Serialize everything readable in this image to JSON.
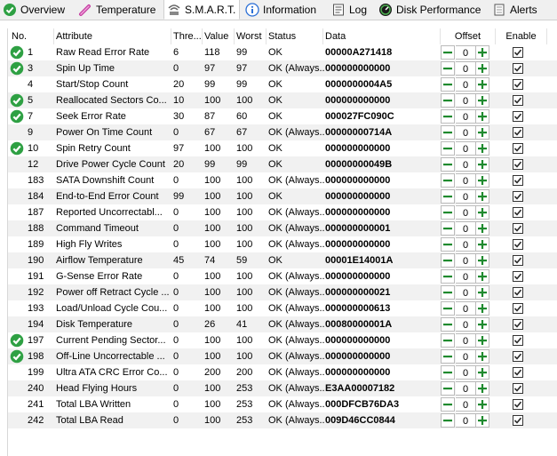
{
  "tabs": [
    {
      "label": "Overview",
      "icon": "check-circle-icon",
      "active": false
    },
    {
      "label": "Temperature",
      "icon": "thermometer-icon",
      "active": false
    },
    {
      "label": "S.M.A.R.T.",
      "icon": "smart-icon",
      "active": true
    },
    {
      "label": "Information",
      "icon": "info-icon",
      "active": false
    },
    {
      "label": "Log",
      "icon": "log-icon",
      "active": false
    },
    {
      "label": "Disk Performance",
      "icon": "disk-performance-icon",
      "active": false
    },
    {
      "label": "Alerts",
      "icon": "alerts-icon",
      "active": false
    }
  ],
  "columns": {
    "no": "No.",
    "attribute": "Attribute",
    "threshold": "Thre...",
    "value": "Value",
    "worst": "Worst",
    "status": "Status",
    "data": "Data",
    "offset": "Offset",
    "enable": "Enable"
  },
  "colors": {
    "ok_green": "#2ea043",
    "stepper_green": "#1f8a2e",
    "row_alt": "#f1f1f1"
  },
  "rows": [
    {
      "no": "1",
      "attribute": "Raw Read Error Rate",
      "threshold": "6",
      "value": "118",
      "worst": "99",
      "status": "OK",
      "data": "00000A271418",
      "offset": "0",
      "ok_icon": true,
      "enabled": true
    },
    {
      "no": "3",
      "attribute": "Spin Up Time",
      "threshold": "0",
      "value": "97",
      "worst": "97",
      "status": "OK (Always...",
      "data": "000000000000",
      "offset": "0",
      "ok_icon": true,
      "enabled": true
    },
    {
      "no": "4",
      "attribute": "Start/Stop Count",
      "threshold": "20",
      "value": "99",
      "worst": "99",
      "status": "OK",
      "data": "0000000004A5",
      "offset": "0",
      "ok_icon": false,
      "enabled": true
    },
    {
      "no": "5",
      "attribute": "Reallocated Sectors Co...",
      "threshold": "10",
      "value": "100",
      "worst": "100",
      "status": "OK",
      "data": "000000000000",
      "offset": "0",
      "ok_icon": true,
      "enabled": true
    },
    {
      "no": "7",
      "attribute": "Seek Error Rate",
      "threshold": "30",
      "value": "87",
      "worst": "60",
      "status": "OK",
      "data": "000027FC090C",
      "offset": "0",
      "ok_icon": true,
      "enabled": true
    },
    {
      "no": "9",
      "attribute": "Power On Time Count",
      "threshold": "0",
      "value": "67",
      "worst": "67",
      "status": "OK (Always...",
      "data": "00000000714A",
      "offset": "0",
      "ok_icon": false,
      "enabled": true
    },
    {
      "no": "10",
      "attribute": "Spin Retry Count",
      "threshold": "97",
      "value": "100",
      "worst": "100",
      "status": "OK",
      "data": "000000000000",
      "offset": "0",
      "ok_icon": true,
      "enabled": true
    },
    {
      "no": "12",
      "attribute": "Drive Power Cycle Count",
      "threshold": "20",
      "value": "99",
      "worst": "99",
      "status": "OK",
      "data": "00000000049B",
      "offset": "0",
      "ok_icon": false,
      "enabled": true
    },
    {
      "no": "183",
      "attribute": "SATA Downshift Count",
      "threshold": "0",
      "value": "100",
      "worst": "100",
      "status": "OK (Always...",
      "data": "000000000000",
      "offset": "0",
      "ok_icon": false,
      "enabled": true
    },
    {
      "no": "184",
      "attribute": "End-to-End Error Count",
      "threshold": "99",
      "value": "100",
      "worst": "100",
      "status": "OK",
      "data": "000000000000",
      "offset": "0",
      "ok_icon": false,
      "enabled": true
    },
    {
      "no": "187",
      "attribute": "Reported Uncorrectabl...",
      "threshold": "0",
      "value": "100",
      "worst": "100",
      "status": "OK (Always...",
      "data": "000000000000",
      "offset": "0",
      "ok_icon": false,
      "enabled": true
    },
    {
      "no": "188",
      "attribute": "Command Timeout",
      "threshold": "0",
      "value": "100",
      "worst": "100",
      "status": "OK (Always...",
      "data": "000000000001",
      "offset": "0",
      "ok_icon": false,
      "enabled": true
    },
    {
      "no": "189",
      "attribute": "High Fly Writes",
      "threshold": "0",
      "value": "100",
      "worst": "100",
      "status": "OK (Always...",
      "data": "000000000000",
      "offset": "0",
      "ok_icon": false,
      "enabled": true
    },
    {
      "no": "190",
      "attribute": "Airflow Temperature",
      "threshold": "45",
      "value": "74",
      "worst": "59",
      "status": "OK",
      "data": "00001E14001A",
      "offset": "0",
      "ok_icon": false,
      "enabled": true
    },
    {
      "no": "191",
      "attribute": "G-Sense Error Rate",
      "threshold": "0",
      "value": "100",
      "worst": "100",
      "status": "OK (Always...",
      "data": "000000000000",
      "offset": "0",
      "ok_icon": false,
      "enabled": true
    },
    {
      "no": "192",
      "attribute": "Power off Retract Cycle ...",
      "threshold": "0",
      "value": "100",
      "worst": "100",
      "status": "OK (Always...",
      "data": "000000000021",
      "offset": "0",
      "ok_icon": false,
      "enabled": true
    },
    {
      "no": "193",
      "attribute": "Load/Unload Cycle Cou...",
      "threshold": "0",
      "value": "100",
      "worst": "100",
      "status": "OK (Always...",
      "data": "000000000613",
      "offset": "0",
      "ok_icon": false,
      "enabled": true
    },
    {
      "no": "194",
      "attribute": "Disk Temperature",
      "threshold": "0",
      "value": "26",
      "worst": "41",
      "status": "OK (Always...",
      "data": "00080000001A",
      "offset": "0",
      "ok_icon": false,
      "enabled": true
    },
    {
      "no": "197",
      "attribute": "Current Pending Sector...",
      "threshold": "0",
      "value": "100",
      "worst": "100",
      "status": "OK (Always...",
      "data": "000000000000",
      "offset": "0",
      "ok_icon": true,
      "enabled": true
    },
    {
      "no": "198",
      "attribute": "Off-Line Uncorrectable ...",
      "threshold": "0",
      "value": "100",
      "worst": "100",
      "status": "OK (Always...",
      "data": "000000000000",
      "offset": "0",
      "ok_icon": true,
      "enabled": true
    },
    {
      "no": "199",
      "attribute": "Ultra ATA CRC Error Co...",
      "threshold": "0",
      "value": "200",
      "worst": "200",
      "status": "OK (Always...",
      "data": "000000000000",
      "offset": "0",
      "ok_icon": false,
      "enabled": true
    },
    {
      "no": "240",
      "attribute": "Head Flying Hours",
      "threshold": "0",
      "value": "100",
      "worst": "253",
      "status": "OK (Always...",
      "data": "E3AA00007182",
      "offset": "0",
      "ok_icon": false,
      "enabled": true
    },
    {
      "no": "241",
      "attribute": "Total LBA Written",
      "threshold": "0",
      "value": "100",
      "worst": "253",
      "status": "OK (Always...",
      "data": "000DFCB76DA3",
      "offset": "0",
      "ok_icon": false,
      "enabled": true
    },
    {
      "no": "242",
      "attribute": "Total LBA Read",
      "threshold": "0",
      "value": "100",
      "worst": "253",
      "status": "OK (Always...",
      "data": "009D46CC0844",
      "offset": "0",
      "ok_icon": false,
      "enabled": true
    }
  ]
}
